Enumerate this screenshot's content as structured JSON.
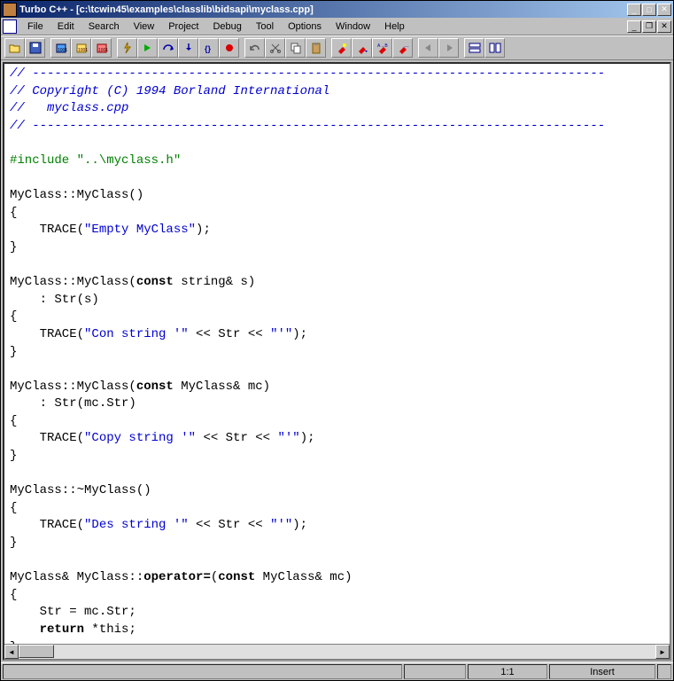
{
  "colors": {
    "titlebar_left": "#0a246a",
    "titlebar_right": "#a6caf0",
    "chrome": "#c0c0c0"
  },
  "title": "Turbo C++ - [c:\\tcwin45\\examples\\classlib\\bidsapi\\myclass.cpp]",
  "menus": [
    "File",
    "Edit",
    "Search",
    "View",
    "Project",
    "Debug",
    "Tool",
    "Options",
    "Window",
    "Help"
  ],
  "toolbar_icons": [
    "open-file",
    "save-file",
    "sep",
    "bin-blue",
    "bin-yellow",
    "bin-red",
    "sep",
    "lightning",
    "run",
    "step-over",
    "step-into",
    "trace",
    "breakpoint",
    "sep",
    "undo",
    "cut",
    "copy",
    "paste",
    "sep",
    "find",
    "find-next",
    "replace",
    "find-brace",
    "sep",
    "go-prev",
    "go-next",
    "sep",
    "tile-horz",
    "tile-vert"
  ],
  "code": {
    "dash_line": "-----------------------------------------------------------------------------",
    "copyright": " Copyright (C) 1994 Borland International",
    "filename_cmt": "   myclass.cpp",
    "include": "#include \"..\\myclass.h\"",
    "cls": "MyClass",
    "scope": "::",
    "const": "const",
    "string_amp": " string& s)",
    "myclass_amp": " MyClass& mc)",
    "return": "return",
    "this": " *this;",
    "operator_eq": "operator=",
    "ctor1_open": "MyClass::MyClass()",
    "ctor2_open": "MyClass::MyClass(",
    "ctor3_open": "MyClass::MyClass(",
    "dtor_open": "MyClass::~MyClass()",
    "init_str_s": "    : Str(s)",
    "init_str_mc": "    : Str(mc.Str)",
    "assign_line": "    Str = mc.Str;",
    "trace_pre": "    TRACE(",
    "trace_mid": " << Str << ",
    "trace_end": ");",
    "s_empty": "\"Empty MyClass\"",
    "s_con": "\"Con string '\"",
    "s_copy": "\"Copy string '\"",
    "s_des": "\"Des string '\"",
    "s_tick": "\"'\"",
    "brace_o": "{",
    "brace_c": "}",
    "amp_decl_prefix": "MyClass& MyClass::",
    "paren_open": "("
  },
  "status": {
    "pos": "1:1",
    "mode": "Insert"
  }
}
